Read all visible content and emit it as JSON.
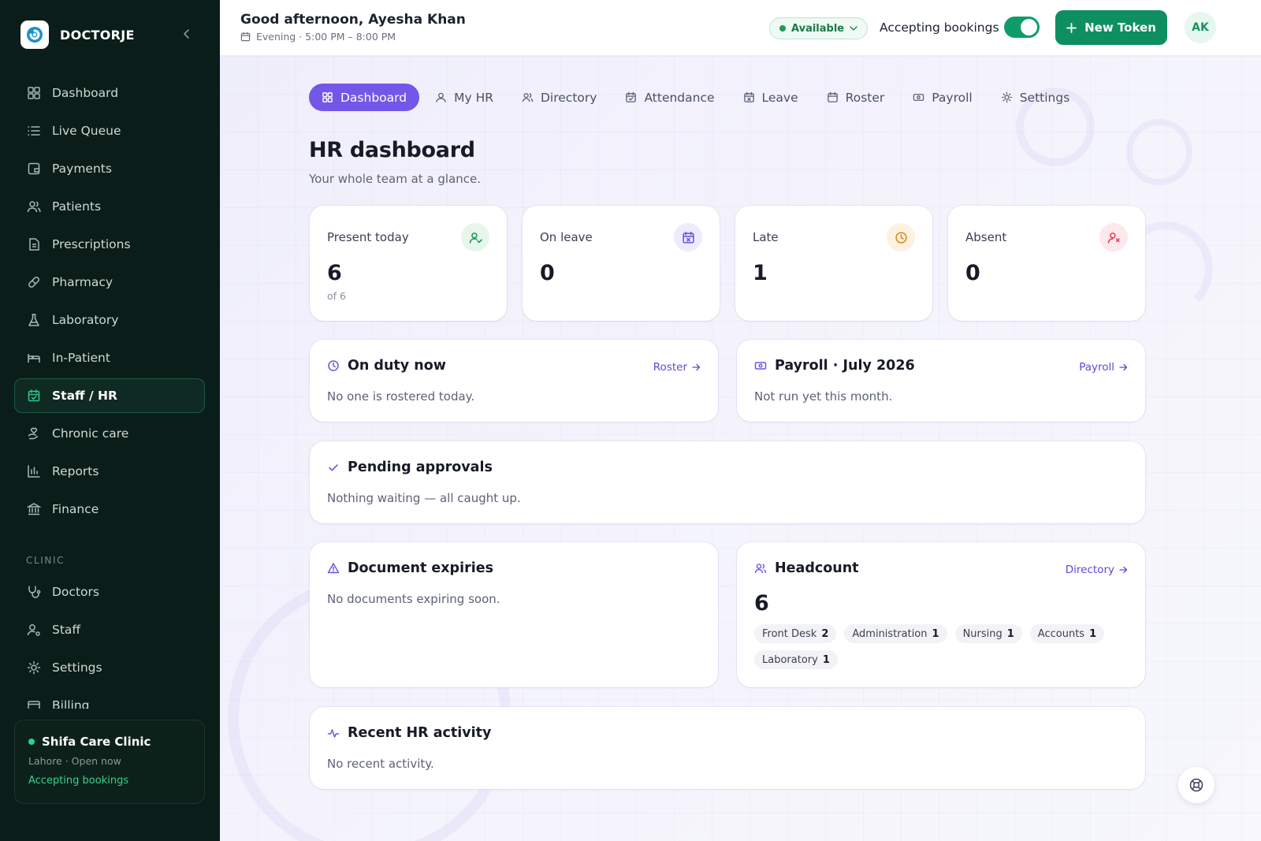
{
  "brand": {
    "name": "DOCTORJE"
  },
  "sidebar": {
    "items": [
      {
        "label": "Dashboard",
        "icon": "grid-icon"
      },
      {
        "label": "Live Queue",
        "icon": "list-icon"
      },
      {
        "label": "Payments",
        "icon": "wallet-icon"
      },
      {
        "label": "Patients",
        "icon": "users-icon"
      },
      {
        "label": "Prescriptions",
        "icon": "file-icon"
      },
      {
        "label": "Pharmacy",
        "icon": "pill-icon"
      },
      {
        "label": "Laboratory",
        "icon": "flask-icon"
      },
      {
        "label": "In-Patient",
        "icon": "bed-icon"
      },
      {
        "label": "Staff / HR",
        "icon": "calendar-check-icon",
        "active": true
      },
      {
        "label": "Chronic care",
        "icon": "heart-hand-icon"
      },
      {
        "label": "Reports",
        "icon": "bar-chart-icon"
      },
      {
        "label": "Finance",
        "icon": "bank-icon"
      }
    ],
    "section_label": "CLINIC",
    "clinic_items": [
      {
        "label": "Doctors",
        "icon": "stethoscope-icon"
      },
      {
        "label": "Staff",
        "icon": "user-cog-icon"
      },
      {
        "label": "Settings",
        "icon": "sun-gear-icon"
      },
      {
        "label": "Billing",
        "icon": "card-icon"
      }
    ],
    "clinic_card": {
      "name": "Shifa Care Clinic",
      "subtitle": "Lahore · Open now",
      "status": "Accepting bookings"
    }
  },
  "header": {
    "greeting": "Good afternoon, Ayesha Khan",
    "shift": "Evening · 5:00 PM – 8:00 PM",
    "availability": "Available",
    "accepting_label": "Accepting bookings",
    "accepting_on": true,
    "new_token_label": "New Token",
    "avatar_initials": "AK"
  },
  "tabs": [
    {
      "label": "Dashboard",
      "icon": "grid-icon",
      "active": true
    },
    {
      "label": "My HR",
      "icon": "user-icon"
    },
    {
      "label": "Directory",
      "icon": "users-icon"
    },
    {
      "label": "Attendance",
      "icon": "calendar-check-icon"
    },
    {
      "label": "Leave",
      "icon": "calendar-x-icon"
    },
    {
      "label": "Roster",
      "icon": "calendar-icon"
    },
    {
      "label": "Payroll",
      "icon": "money-icon"
    },
    {
      "label": "Settings",
      "icon": "sun-gear-icon"
    }
  ],
  "page": {
    "title": "HR dashboard",
    "subtitle": "Your whole team at a glance."
  },
  "stats": [
    {
      "label": "Present today",
      "value": "6",
      "sub": "of 6",
      "icon": "user-check-icon",
      "color": "#1f9a5c",
      "bg": "#e6f6ec"
    },
    {
      "label": "On leave",
      "value": "0",
      "sub": "",
      "icon": "calendar-x-icon",
      "color": "#6d55e0",
      "bg": "#efebfc"
    },
    {
      "label": "Late",
      "value": "1",
      "sub": "",
      "icon": "clock-icon",
      "color": "#d98a1a",
      "bg": "#fdf1e0"
    },
    {
      "label": "Absent",
      "value": "0",
      "sub": "",
      "icon": "user-x-icon",
      "color": "#e0445a",
      "bg": "#fde8eb"
    }
  ],
  "on_duty": {
    "title": "On duty now",
    "link": "Roster",
    "body": "No one is rostered today."
  },
  "payroll": {
    "title": "Payroll · July 2026",
    "link": "Payroll",
    "body": "Not run yet this month."
  },
  "pending": {
    "title": "Pending approvals",
    "body": "Nothing waiting — all caught up."
  },
  "documents": {
    "title": "Document expiries",
    "body": "No documents expiring soon."
  },
  "headcount": {
    "title": "Headcount",
    "link": "Directory",
    "total": "6",
    "departments": [
      {
        "name": "Front Desk",
        "count": "2"
      },
      {
        "name": "Administration",
        "count": "1"
      },
      {
        "name": "Nursing",
        "count": "1"
      },
      {
        "name": "Accounts",
        "count": "1"
      },
      {
        "name": "Laboratory",
        "count": "1"
      }
    ]
  },
  "activity": {
    "title": "Recent HR activity",
    "body": "No recent activity."
  },
  "colors": {
    "accent": "#7257e8",
    "brand_green": "#0e8f60",
    "sidebar_bg": "#0b1d18"
  }
}
